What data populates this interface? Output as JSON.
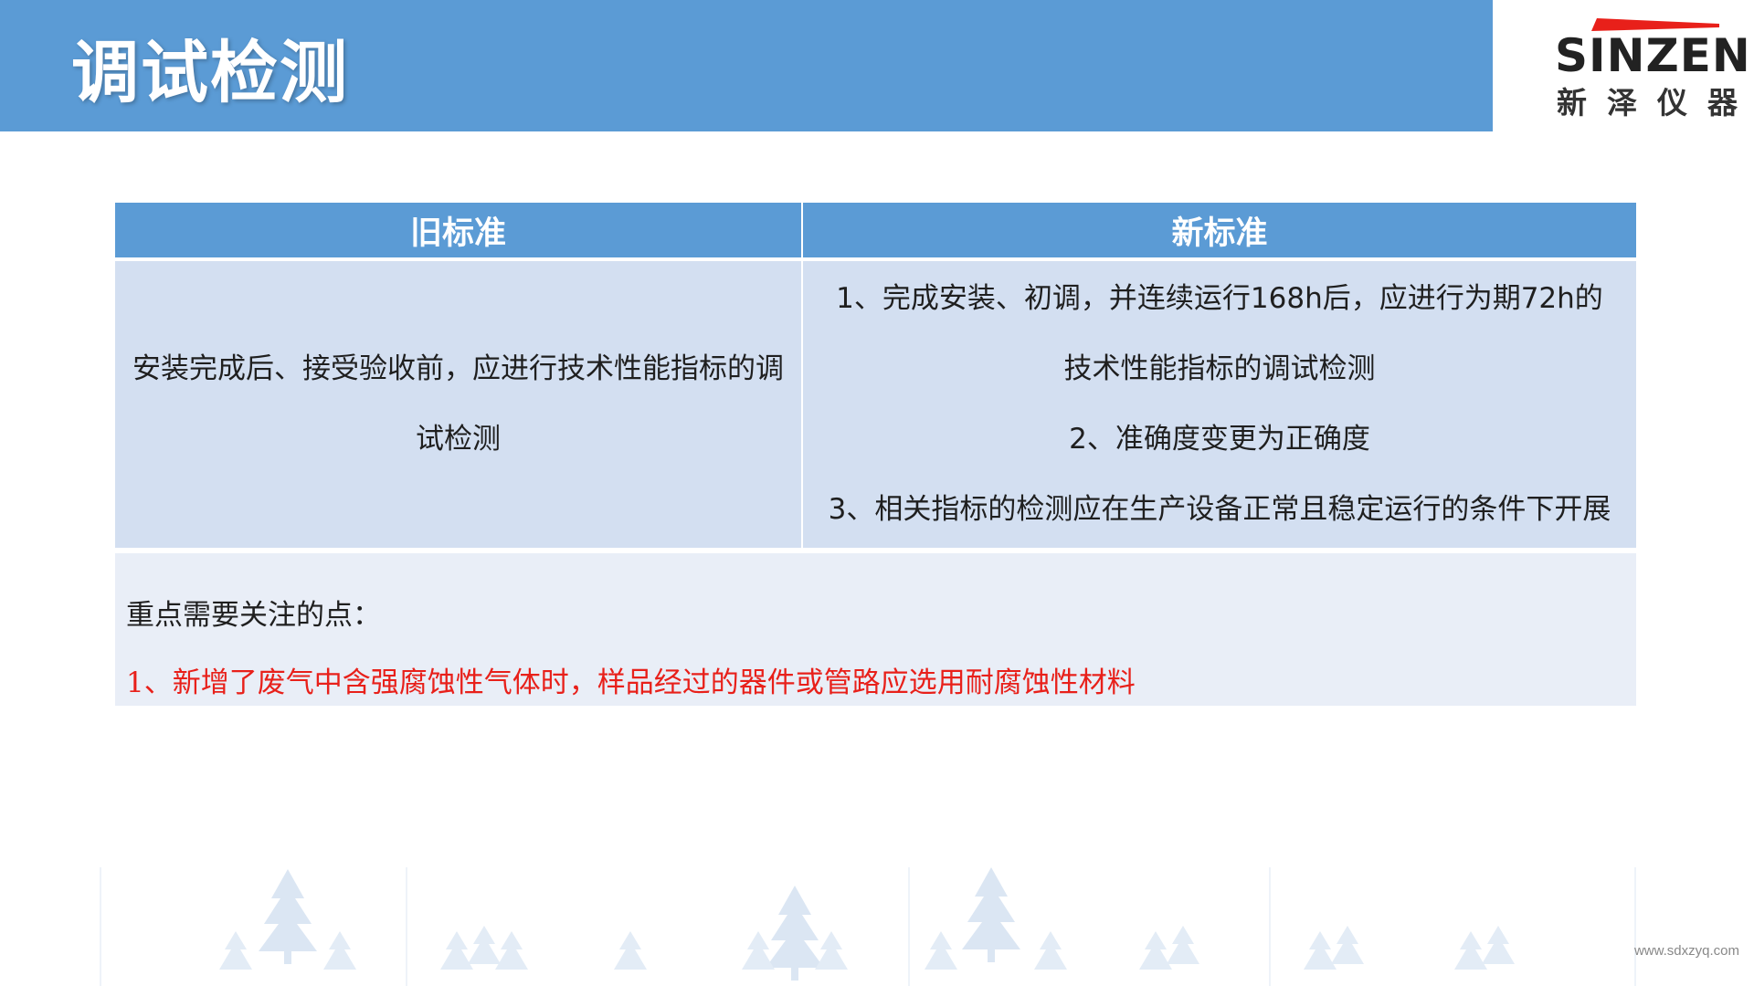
{
  "header": {
    "title": "调试检测"
  },
  "logo": {
    "name": "SINZEN",
    "subtitle": "新泽仪器",
    "accent_color": "#e8201a"
  },
  "table": {
    "headers": {
      "old": "旧标准",
      "new": "新标准"
    },
    "old_text": "安装完成后、接受验收前，应进行技术性能指标的调试检测",
    "new_items": [
      "1、完成安装、初调，并连续运行168h后，应进行为期72h的",
      "技术性能指标的调试检测",
      "2、准确度变更为正确度",
      "3、相关指标的检测应在生产设备正常且稳定运行的条件下开展"
    ]
  },
  "key_points": {
    "heading": "重点需要关注的点：",
    "items": [
      "1、新增了废气中含强腐蚀性气体时，样品经过的器件或管路应选用耐腐蚀性材料"
    ]
  },
  "footer": {
    "url": "www.sdxzyq.com"
  },
  "colors": {
    "header_blue": "#5b9bd5",
    "cell_blue": "#d3dff1",
    "key_box": "#e9eef7",
    "highlight_red": "#e8201a"
  }
}
